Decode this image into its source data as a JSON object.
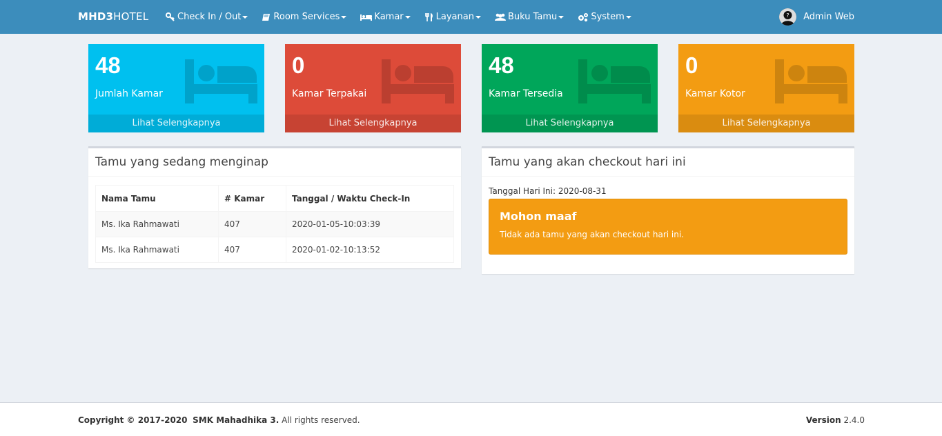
{
  "navbar": {
    "brand_bold": "MHD3",
    "brand_rest": "HOTEL",
    "items": [
      {
        "label": "Check In / Out",
        "icon": "key-icon"
      },
      {
        "label": "Room Services",
        "icon": "book-icon"
      },
      {
        "label": "Kamar",
        "icon": "bed-icon"
      },
      {
        "label": "Layanan",
        "icon": "cutlery-icon"
      },
      {
        "label": "Buku Tamu",
        "icon": "users-icon"
      },
      {
        "label": "System",
        "icon": "cogs-icon"
      }
    ],
    "user": "Admin Web"
  },
  "stats": [
    {
      "value": "48",
      "label": "Jumlah Kamar",
      "link": "Lihat Selengkapnya",
      "color": "#00c0ef"
    },
    {
      "value": "0",
      "label": "Kamar Terpakai",
      "link": "Lihat Selengkapnya",
      "color": "#dd4b39"
    },
    {
      "value": "48",
      "label": "Kamar Tersedia",
      "link": "Lihat Selengkapnya",
      "color": "#00a65a"
    },
    {
      "value": "0",
      "label": "Kamar Kotor",
      "link": "Lihat Selengkapnya",
      "color": "#f39c12"
    }
  ],
  "staying": {
    "title": "Tamu yang sedang menginap",
    "columns": [
      "Nama Tamu",
      "# Kamar",
      "Tanggal / Waktu Check-In"
    ],
    "rows": [
      [
        "Ms. Ika Rahmawati",
        "407",
        "2020-01-05-10:03:39"
      ],
      [
        "Ms. Ika Rahmawati",
        "407",
        "2020-01-02-10:13:52"
      ]
    ]
  },
  "checkout": {
    "title": "Tamu yang akan checkout hari ini",
    "date_line": "Tanggal Hari Ini: 2020-08-31",
    "alert_title": "Mohon maaf",
    "alert_text": "Tidak ada tamu yang akan checkout hari ini."
  },
  "footer": {
    "copyright_prefix": "Copyright © 2017-2020",
    "org": "SMK Mahadhika 3.",
    "rights": "All rights reserved.",
    "version_label": "Version",
    "version": "2.4.0"
  }
}
